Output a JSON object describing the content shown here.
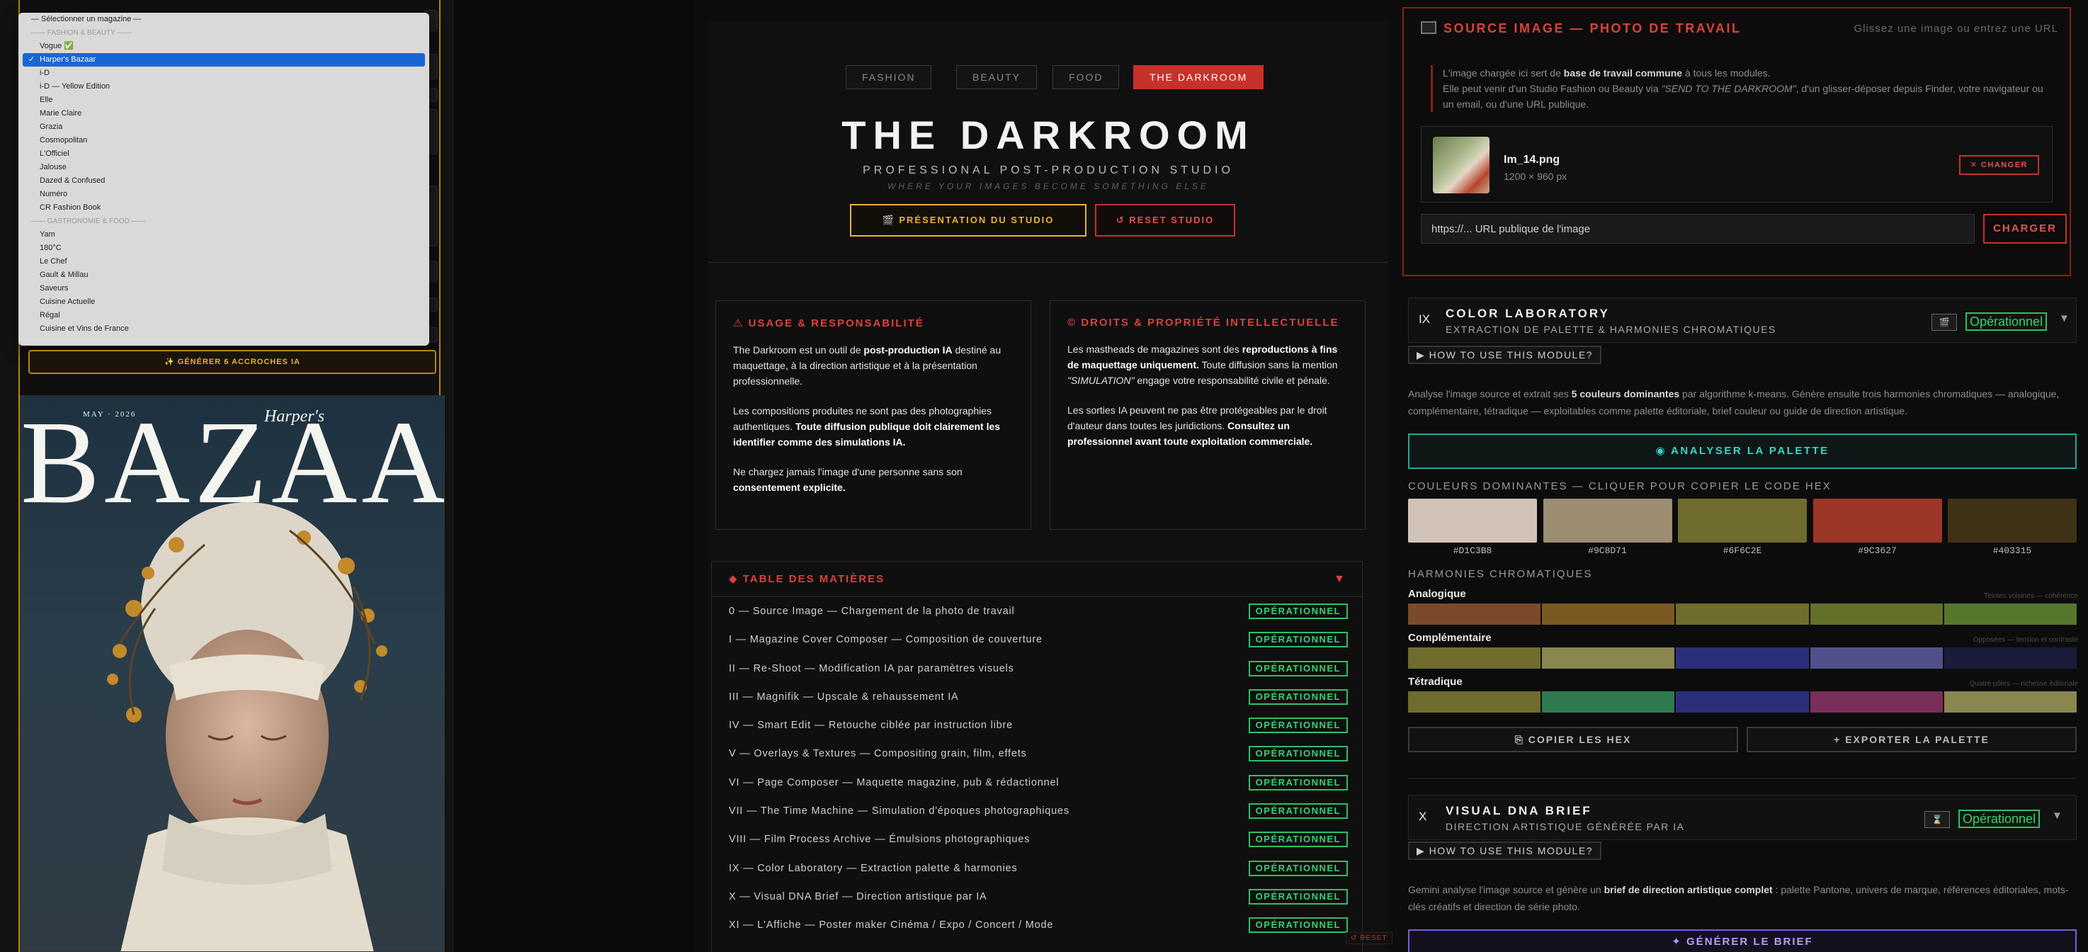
{
  "magazine_dropdown": {
    "placeholder": "— Sélectionner un magazine —",
    "group_fashion": "—— FASHION & BEAUTY ——",
    "items_fashion": [
      "Vogue ✅",
      "Harper's Bazaar",
      "i-D",
      "i-D — Yellow Edition",
      "Elle",
      "Marie Claire",
      "Grazia",
      "Cosmopolitan",
      "L'Officiel",
      "Jalouse",
      "Dazed & Confused",
      "Numéro",
      "CR Fashion Book"
    ],
    "selected": "Harper's Bazaar",
    "group_food": "—— GASTRONOMIE & FOOD ——",
    "items_food": [
      "Yam",
      "180°C",
      "Le Chef",
      "Gault & Millau",
      "Saveurs",
      "Cuisine Actuelle",
      "Régal",
      "Cuisine et Vins de France"
    ]
  },
  "left_panel": {
    "generate_hooks": "✨ GÉNÉRER 6 ACCROCHES IA"
  },
  "cover": {
    "magazine": "BAZAAR",
    "script": "Harper's",
    "date": "MAY · 2026"
  },
  "studio": {
    "tabs": [
      "FASHION",
      "BEAUTY",
      "FOOD",
      "THE DARKROOM"
    ],
    "active_tab": "THE DARKROOM",
    "title": "THE DARKROOM",
    "subtitle": "PROFESSIONAL POST-PRODUCTION STUDIO",
    "tagline": "WHERE YOUR IMAGES BECOME SOMETHING ELSE",
    "presentation_btn": "🎬 PRÉSENTATION DU STUDIO",
    "reset_btn": "↺ RESET STUDIO",
    "reset_mini": "↺ RESET"
  },
  "usage_card": {
    "title": "⚠ USAGE & RESPONSABILITÉ",
    "p1_a": "The Darkroom est un outil de ",
    "p1_b": "post-production IA",
    "p1_c": " destiné au maquettage, à la direction artistique et à la présentation professionnelle.",
    "p2_a": "Les compositions produites ne sont pas des photographies authentiques. ",
    "p2_b": "Toute diffusion publique doit clairement les identifier comme des simulations IA.",
    "p3_a": "Ne chargez jamais l'image d'une personne sans son ",
    "p3_b": "consentement explicite."
  },
  "rights_card": {
    "title": "© DROITS & PROPRIÉTÉ INTELLECTUELLE",
    "p1_a": "Les mastheads de magazines sont des ",
    "p1_b": "reproductions à fins de maquettage uniquement.",
    "p1_c": " Toute diffusion sans la mention ",
    "p1_d": "\"SIMULATION\"",
    "p1_e": " engage votre responsabilité civile et pénale.",
    "p2_a": "Les sorties IA peuvent ne pas être protégeables par le droit d'auteur dans toutes les juridictions. ",
    "p2_b": "Consultez un professionnel avant toute exploitation commerciale."
  },
  "toc": {
    "title": "◆ TABLE DES MATIÈRES",
    "caret": "▼",
    "badge": "OPÉRATIONNEL",
    "rows": [
      "0 — Source Image — Chargement de la photo de travail",
      "I — Magazine Cover Composer — Composition de couverture",
      "II — Re-Shoot — Modification IA par paramètres visuels",
      "III — Magnifik — Upscale & rehaussement IA",
      "IV — Smart Edit — Retouche ciblée par instruction libre",
      "V — Overlays & Textures — Compositing grain, film, effets",
      "VI — Page Composer — Maquette magazine, pub & rédactionnel",
      "VII — The Time Machine — Simulation d'époques photographiques",
      "VIII — Film Process Archive — Émulsions photographiques",
      "IX — Color Laboratory — Extraction palette & harmonies",
      "X — Visual DNA Brief — Direction artistique par IA",
      "XI — L'Affiche — Poster maker Cinéma / Expo / Concert / Mode"
    ]
  },
  "source": {
    "title": "SOURCE IMAGE — PHOTO DE TRAVAIL",
    "hint": "Glissez une image ou entrez une URL",
    "desc_a": "L'image chargée ici sert de ",
    "desc_b": "base de travail commune",
    "desc_c": " à tous les modules.",
    "desc_d": "Elle peut venir d'un Studio Fashion ou Beauty via ",
    "desc_e": "\"SEND TO THE DARKROOM\"",
    "desc_f": ", d'un glisser-déposer depuis Finder, votre navigateur ou un email, ou d'une URL publique.",
    "file_name": "Im_14.png",
    "file_dim": "1200 × 960 px",
    "change_btn": "✕ CHANGER",
    "url_placeholder": "https://... URL publique de l'image",
    "load_btn": "CHARGER"
  },
  "color_lab": {
    "roman": "IX",
    "title": "COLOR LABORATORY",
    "subtitle": "EXTRACTION DE PALETTE & HARMONIES CHROMATIQUES",
    "icon_btn": "🎬",
    "status": "Opérationnel",
    "caret": "▼",
    "howto": "▶ HOW TO USE THIS MODULE?",
    "desc_a": "Analyse l'image source et extrait ses ",
    "desc_b": "5 couleurs dominantes",
    "desc_c": " par algorithme k-means. Génère ensuite trois harmonies chromatiques — analogique, complémentaire, tétradique — exploitables comme palette éditoriale, brief couleur ou guide de direction artistique.",
    "analyse_btn": "◉ ANALYSER LA PALETTE",
    "dominant_label": "COULEURS DOMINANTES — CLIQUER POUR COPIER LE CODE HEX",
    "swatches": [
      "#D1C3B8",
      "#9C8D71",
      "#6F6C2E",
      "#9C3627",
      "#403315"
    ],
    "harmonies_label": "HARMONIES CHROMATIQUES",
    "harmonies": [
      {
        "name": "Analogique",
        "note": "Teintes voisines — cohérence",
        "colors": [
          "#7a4a2a",
          "#7a5a22",
          "#6f6c2e",
          "#62702a",
          "#55762c"
        ]
      },
      {
        "name": "Complémentaire",
        "note": "Opposées — tension et contraste",
        "colors": [
          "#6f6c2e",
          "#8a8650",
          "#2e2f7a",
          "#50508a",
          "#1b1b3a"
        ]
      },
      {
        "name": "Tétradique",
        "note": "Quatre pôles — richesse éditoriale",
        "colors": [
          "#6f6c2e",
          "#2e7a4e",
          "#2e2f7a",
          "#7a2e5a",
          "#8a8650"
        ]
      }
    ],
    "copy_btn": "⎘ COPIER LES HEX",
    "export_btn": "+ EXPORTER LA PALETTE"
  },
  "visual_dna": {
    "roman": "X",
    "title": "VISUAL DNA BRIEF",
    "subtitle": "DIRECTION ARTISTIQUE GÉNÉRÉE PAR IA",
    "icon_btn": "⌛",
    "status": "Opérationnel",
    "caret": "▼",
    "howto": "▶ HOW TO USE THIS MODULE?",
    "desc_a": "Gemini analyse l'image source et génère un ",
    "desc_b": "brief de direction artistique complet",
    "desc_c": " : palette Pantone, univers de marque, références éditoriales, mots-clés créatifs et direction de série photo.",
    "generate_btn": "✦ GÉNÉRER LE BRIEF"
  }
}
